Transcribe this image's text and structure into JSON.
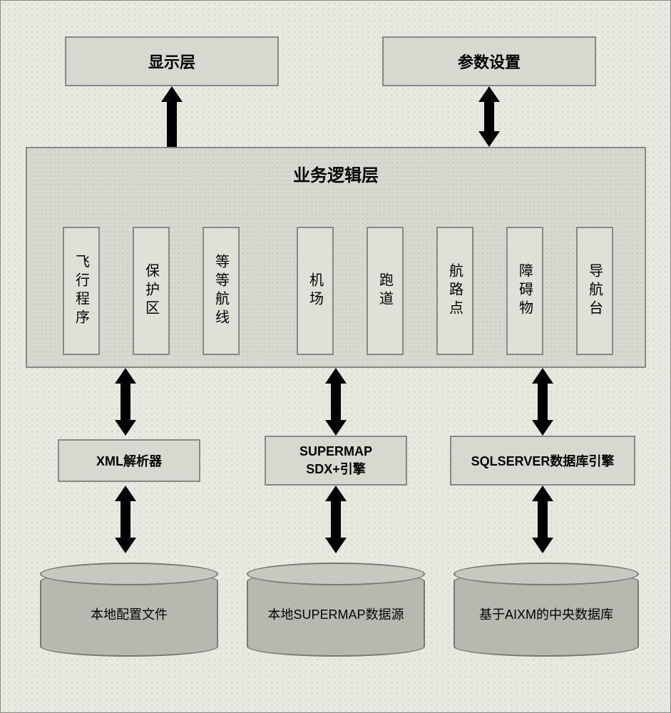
{
  "top": {
    "display_layer": "显示层",
    "param_settings": "参数设置"
  },
  "logic": {
    "title": "业务逻辑层",
    "modules": [
      "飞行程序",
      "保护区",
      "等等航线",
      "机场",
      "跑道",
      "航路点",
      "障碍物",
      "导航台"
    ]
  },
  "engines": {
    "xml": "XML解析器",
    "supermap": "SUPERMAP\nSDX+引擎",
    "sqlserver": "SQLSERVER数据库引擎"
  },
  "stores": {
    "local_config": "本地配置文件",
    "local_supermap": "本地SUPERMAP数据源",
    "aixm_db": "基于AIXM的中央数据库"
  }
}
